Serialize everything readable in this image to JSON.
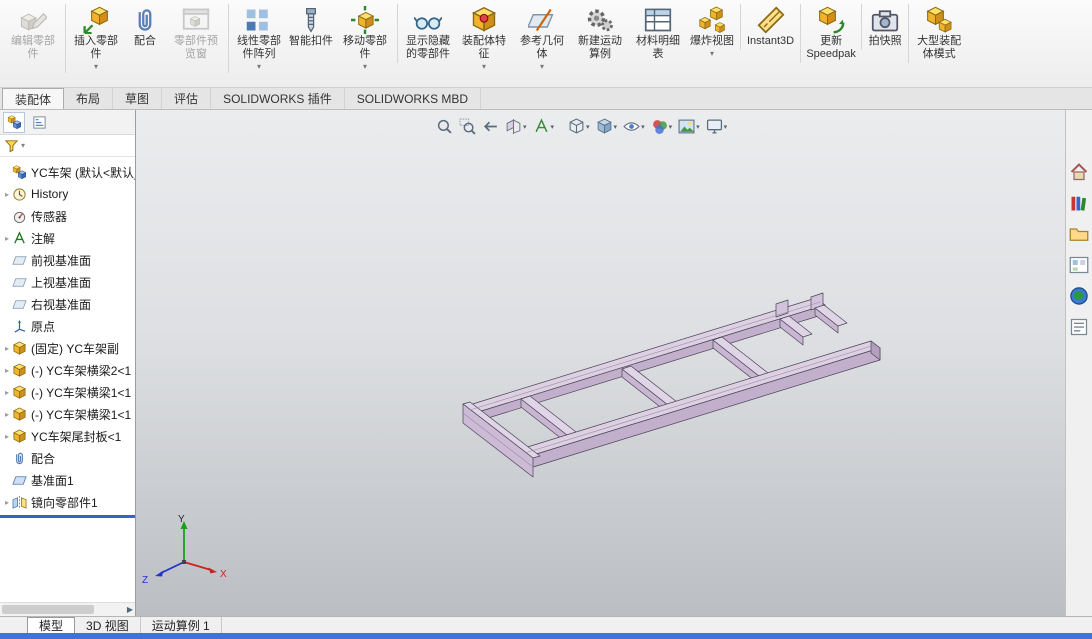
{
  "colors": {
    "status_bar": "#3f74d4",
    "selection_accent": "#2e66c9",
    "model_top_face": "#dcd0e2",
    "model_side_face": "#c6b4cf"
  },
  "ribbon": {
    "buttons": [
      {
        "name": "edit-component-button",
        "label": "编辑零部件",
        "icon": "edit-component",
        "disabled": true
      },
      {
        "name": "insert-components-button",
        "label": "插入零部件",
        "icon": "insert-component",
        "caret": true,
        "divider": true
      },
      {
        "name": "mate-button",
        "label": "配合",
        "icon": "mate"
      },
      {
        "name": "component-preview-window-button",
        "label": "零部件预览窗",
        "icon": "preview-window",
        "disabled": true
      },
      {
        "name": "linear-component-pattern-button",
        "label": "线性零部件阵列",
        "icon": "pattern",
        "caret": true,
        "divider": true
      },
      {
        "name": "smart-fasteners-button",
        "label": "智能扣件",
        "icon": "fastener"
      },
      {
        "name": "move-component-button",
        "label": "移动零部件",
        "icon": "move-component",
        "caret": true
      },
      {
        "name": "show-hidden-components-button",
        "label": "显示隐藏的零部件",
        "icon": "show-hidden",
        "divider": true
      },
      {
        "name": "assembly-features-button",
        "label": "装配体特征",
        "icon": "asm-features",
        "caret": true
      },
      {
        "name": "reference-geometry-button",
        "label": "参考几何体",
        "icon": "refgeo",
        "caret": true
      },
      {
        "name": "new-motion-study-button",
        "label": "新建运动算例",
        "icon": "motion"
      },
      {
        "name": "bill-of-materials-button",
        "label": "材料明细表",
        "icon": "bom"
      },
      {
        "name": "exploded-view-button",
        "label": "爆炸视图",
        "icon": "exploded",
        "caret": true
      },
      {
        "name": "instant3d-button",
        "label": "Instant3D",
        "icon": "instant3d",
        "divider": true
      },
      {
        "name": "update-speedpak-button",
        "label": "更新 Speedpak",
        "icon": "speedpak",
        "divider": true
      },
      {
        "name": "take-snapshot-button",
        "label": "拍快照",
        "icon": "snapshot",
        "divider": true
      },
      {
        "name": "large-assembly-mode-button",
        "label": "大型装配体模式",
        "icon": "large-asm",
        "divider": true
      }
    ]
  },
  "command_tabs": [
    {
      "name": "tab-assembly",
      "label": "装配体",
      "active": true
    },
    {
      "name": "tab-layout",
      "label": "布局"
    },
    {
      "name": "tab-sketch",
      "label": "草图"
    },
    {
      "name": "tab-evaluate",
      "label": "评估"
    },
    {
      "name": "tab-solidworks-addins",
      "label": "SOLIDWORKS 插件"
    },
    {
      "name": "tab-solidworks-mbd",
      "label": "SOLIDWORKS MBD"
    }
  ],
  "window_controls": [
    {
      "name": "doc-window-button-1",
      "glyph": "▫"
    },
    {
      "name": "doc-window-button-2",
      "glyph": "▫"
    },
    {
      "name": "minimize-button",
      "glyph": "–"
    },
    {
      "name": "restore-button",
      "glyph": "□"
    },
    {
      "name": "close-button",
      "glyph": "✕"
    }
  ],
  "feature_tree": {
    "items": [
      {
        "name": "tree-item-assembly-root",
        "label": "YC车架 (默认<默认_",
        "icon": "assembly"
      },
      {
        "name": "tree-item-history",
        "label": "History",
        "icon": "history",
        "arrow": true
      },
      {
        "name": "tree-item-sensors",
        "label": "传感器",
        "icon": "sensor"
      },
      {
        "name": "tree-item-annotations",
        "label": "注解",
        "icon": "annotation",
        "arrow": true
      },
      {
        "name": "tree-item-front-plane",
        "label": "前视基准面",
        "icon": "plane"
      },
      {
        "name": "tree-item-top-plane",
        "label": "上视基准面",
        "icon": "plane"
      },
      {
        "name": "tree-item-right-plane",
        "label": "右视基准面",
        "icon": "plane"
      },
      {
        "name": "tree-item-origin",
        "label": "原点",
        "icon": "origin"
      },
      {
        "name": "tree-item-component-fixed",
        "label": "(固定) YC车架副",
        "icon": "part",
        "arrow": true
      },
      {
        "name": "tree-item-crossbeam2",
        "label": "(-) YC车架横梁2<1",
        "icon": "part",
        "arrow": true
      },
      {
        "name": "tree-item-crossbeam1a",
        "label": "(-) YC车架横梁1<1",
        "icon": "part",
        "arrow": true
      },
      {
        "name": "tree-item-crossbeam1b",
        "label": "(-) YC车架横梁1<1",
        "icon": "part",
        "arrow": true
      },
      {
        "name": "tree-item-tail-plate",
        "label": "YC车架尾封板<1",
        "icon": "part",
        "arrow": true
      },
      {
        "name": "tree-item-mates",
        "label": "配合",
        "icon": "mate"
      },
      {
        "name": "tree-item-plane1",
        "label": "基准面1",
        "icon": "plane1"
      },
      {
        "name": "tree-item-mirror-component",
        "label": "镜向零部件1",
        "icon": "mirror",
        "arrow": true
      }
    ]
  },
  "heads_up": [
    {
      "name": "zoom-fit-button",
      "icon": "zoom-fit"
    },
    {
      "name": "zoom-area-button",
      "icon": "zoom-area"
    },
    {
      "name": "previous-view-button",
      "icon": "previous-view"
    },
    {
      "name": "section-view-button",
      "icon": "section",
      "caret": true
    },
    {
      "name": "annotation-view-button",
      "icon": "annotation-view",
      "caret": true
    },
    {
      "name": "view-orientation-button",
      "icon": "view-orient",
      "caret": true
    },
    {
      "name": "display-style-button",
      "icon": "display-style",
      "caret": true
    },
    {
      "name": "hide-show-items-button",
      "icon": "eye",
      "caret": true
    },
    {
      "name": "edit-appearance-button",
      "icon": "appearance",
      "caret": true
    },
    {
      "name": "apply-scene-button",
      "icon": "scene",
      "caret": true
    },
    {
      "name": "view-settings-button",
      "icon": "monitor",
      "caret": true
    }
  ],
  "task_pane": [
    {
      "name": "taskpane-home-button",
      "icon": "home"
    },
    {
      "name": "taskpane-design-library-button",
      "icon": "design-library"
    },
    {
      "name": "taskpane-file-explorer-button",
      "icon": "file-explorer"
    },
    {
      "name": "taskpane-view-palette-button",
      "icon": "view-palette"
    },
    {
      "name": "taskpane-appearances-button",
      "icon": "appearances"
    },
    {
      "name": "taskpane-custom-properties-button",
      "icon": "custom-props"
    }
  ],
  "panel_nav": [
    {
      "name": "panel-tab-prev-button",
      "glyph": "◀"
    },
    {
      "name": "panel-tab-next-button",
      "glyph": "▶"
    }
  ],
  "bottom_bar": {
    "nav": [
      {
        "name": "first-tab-button",
        "glyph": "|◀"
      },
      {
        "name": "prev-tab-button",
        "glyph": "◀"
      },
      {
        "name": "next-tab-button",
        "glyph": "▶"
      },
      {
        "name": "last-tab-button",
        "glyph": "▶|"
      }
    ],
    "tabs": [
      {
        "name": "bottom-tab-model",
        "label": "模型",
        "active": true
      },
      {
        "name": "bottom-tab-3d-views",
        "label": "3D 视图"
      },
      {
        "name": "bottom-tab-motion-study",
        "label": "运动算例 1"
      }
    ]
  },
  "viewport": {
    "triad": {
      "x_label": "X",
      "y_label": "Y",
      "z_label": "Z"
    }
  }
}
